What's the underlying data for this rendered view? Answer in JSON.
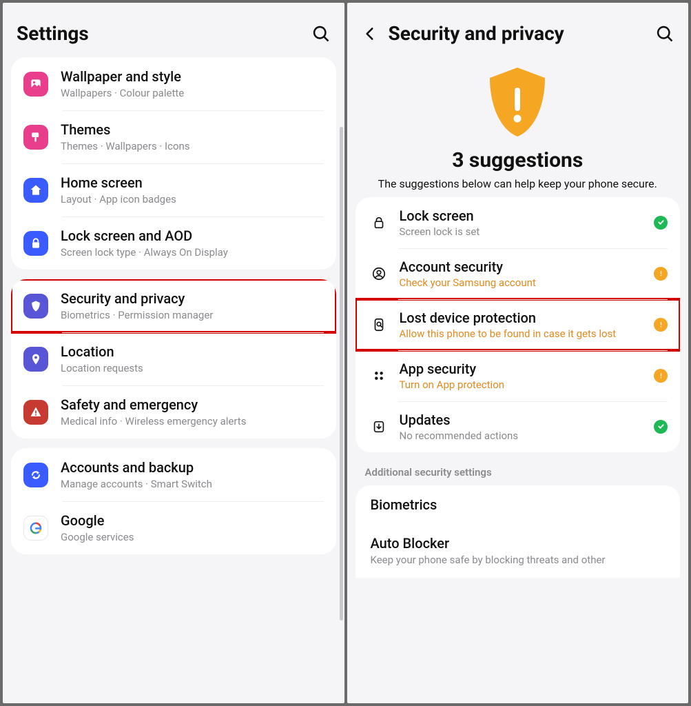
{
  "left": {
    "title": "Settings",
    "groups": [
      {
        "items": [
          {
            "key": "wallpaper",
            "icon": "picture",
            "iconBg": "#e83e8c",
            "title": "Wallpaper and style",
            "subtitle": "Wallpapers  ·  Colour palette"
          },
          {
            "key": "themes",
            "icon": "paint",
            "iconBg": "#e83e8c",
            "title": "Themes",
            "subtitle": "Themes  ·  Wallpapers  ·  Icons"
          },
          {
            "key": "home",
            "icon": "home",
            "iconBg": "#3a5bff",
            "title": "Home screen",
            "subtitle": "Layout  ·  App icon badges"
          },
          {
            "key": "lockscreen",
            "icon": "lock",
            "iconBg": "#3a5bff",
            "title": "Lock screen and AOD",
            "subtitle": "Screen lock type  ·  Always On Display"
          }
        ]
      },
      {
        "items": [
          {
            "key": "security",
            "icon": "shield",
            "iconBg": "#5856d6",
            "title": "Security and privacy",
            "subtitle": "Biometrics  ·  Permission manager",
            "highlight": true
          },
          {
            "key": "location",
            "icon": "pin",
            "iconBg": "#5856d6",
            "title": "Location",
            "subtitle": "Location requests"
          },
          {
            "key": "safety",
            "icon": "alert",
            "iconBg": "#c73a32",
            "title": "Safety and emergency",
            "subtitle": "Medical info  ·  Wireless emergency alerts"
          }
        ]
      },
      {
        "items": [
          {
            "key": "accounts",
            "icon": "sync",
            "iconBg": "#3a5bff",
            "title": "Accounts and backup",
            "subtitle": "Manage accounts  ·  Smart Switch"
          },
          {
            "key": "google",
            "icon": "google",
            "iconBg": "#ffffff",
            "title": "Google",
            "subtitle": "Google services"
          }
        ]
      }
    ]
  },
  "right": {
    "title": "Security and privacy",
    "hero": {
      "heading": "3 suggestions",
      "sub": "The suggestions below can help keep your phone secure."
    },
    "suggestions": [
      {
        "key": "lock",
        "icon": "padlock",
        "title": "Lock screen",
        "subtitle": "Screen lock is set",
        "subClass": "gray",
        "status": "green"
      },
      {
        "key": "account",
        "icon": "person",
        "title": "Account security",
        "subtitle": "Check your Samsung account",
        "subClass": "orange",
        "status": "orange"
      },
      {
        "key": "lost",
        "icon": "find",
        "title": "Lost device protection",
        "subtitle": "Allow this phone to be found in case it gets lost",
        "subClass": "orange",
        "status": "orange",
        "highlight": true
      },
      {
        "key": "appsec",
        "icon": "dots",
        "title": "App security",
        "subtitle": "Turn on App protection",
        "subClass": "orange",
        "status": "orange"
      },
      {
        "key": "updates",
        "icon": "download",
        "title": "Updates",
        "subtitle": "No recommended actions",
        "subClass": "gray",
        "status": "green"
      }
    ],
    "additional": {
      "label": "Additional security settings",
      "items": [
        {
          "key": "biometrics",
          "title": "Biometrics",
          "subtitle": ""
        },
        {
          "key": "autoblocker",
          "title": "Auto Blocker",
          "subtitle": "Keep your phone safe by blocking threats and other"
        }
      ]
    }
  }
}
